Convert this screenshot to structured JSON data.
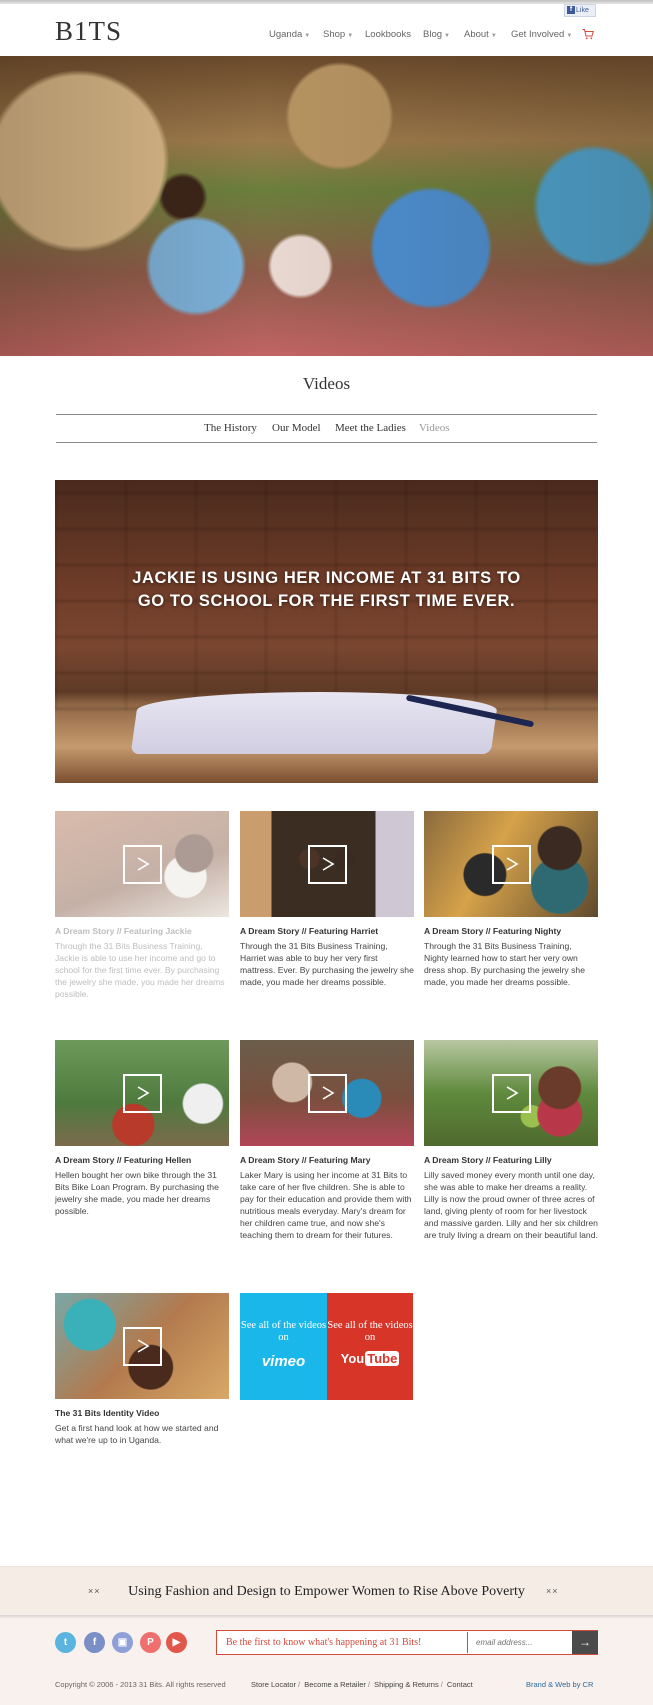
{
  "header": {
    "logo": "B1TS",
    "fb_like": "Like",
    "nav": [
      {
        "label": "Uganda",
        "dropdown": true
      },
      {
        "label": "Shop",
        "dropdown": true
      },
      {
        "label": "Lookbooks",
        "dropdown": false
      },
      {
        "label": "Blog",
        "dropdown": true
      },
      {
        "label": "About",
        "dropdown": true
      },
      {
        "label": "Get Involved",
        "dropdown": true
      }
    ],
    "cart_icon": "cart-icon"
  },
  "page": {
    "title": "Videos",
    "subnav": [
      {
        "label": "The History",
        "active": false
      },
      {
        "label": "Our Model",
        "active": false
      },
      {
        "label": "Meet the Ladies",
        "active": false
      },
      {
        "label": "Videos",
        "active": true
      }
    ]
  },
  "feature": {
    "line1": "JACKIE IS USING HER INCOME AT 31 BITS TO",
    "line2": "GO TO SCHOOL FOR THE FIRST TIME EVER."
  },
  "videos": [
    {
      "title": "A Dream Story // Featuring Jackie",
      "desc": "Through the 31 Bits Business Training, Jackie is able to use her income and go to school for the first time ever. By purchasing the jewelry she made, you made her dreams possible.",
      "faded": true
    },
    {
      "title": "A Dream Story // Featuring Harriet",
      "desc": "Through the 31 Bits Business Training, Harriet was able to buy her very first mattress. Ever. By purchasing the jewelry she made, you made her dreams possible.",
      "faded": false
    },
    {
      "title": "A Dream Story // Featuring Nighty",
      "desc": "Through the 31 Bits Business Training, Nighty learned how to start her very own dress shop. By purchasing the jewelry she made, you made her dreams possible.",
      "faded": false
    },
    {
      "title": "A Dream Story // Featuring Hellen",
      "desc": "Hellen bought her own bike through the 31 Bits Bike Loan Program. By purchasing the jewelry she made, you made her dreams possible.",
      "faded": false
    },
    {
      "title": "A Dream Story // Featuring Mary",
      "desc": "Laker Mary is using her income at 31 Bits to take care of her five children. She is able to pay for their education and provide them with nutritious meals everyday. Mary's dream for her children came true, and now she's teaching them to dream for their futures.",
      "faded": false
    },
    {
      "title": "A Dream Story // Featuring Lilly",
      "desc": "Lilly saved money every month until one day, she was able to make her dreams a reality. Lilly is now the proud owner of three acres of land, giving plenty of room for her livestock and massive garden. Lilly and her six children are truly living a dream on their beautiful land.",
      "faded": false
    },
    {
      "title": "The 31 Bits Identity Video",
      "desc": "Get a first hand look at how we started and what we're up to in Uganda.",
      "faded": false
    }
  ],
  "promo": {
    "vimeo_text": "See all of the videos on",
    "vimeo_logo": "vimeo",
    "youtube_text": "See all of the videos on",
    "youtube_logo_you": "You",
    "youtube_logo_tube": "Tube"
  },
  "footer": {
    "tagline": "Using Fashion and Design to Empower Women to Rise Above Poverty",
    "tagline_mark": "××",
    "social": [
      {
        "name": "twitter-icon",
        "glyph": "t",
        "color": "#5bb4e0"
      },
      {
        "name": "facebook-icon",
        "glyph": "f",
        "color": "#7a8fc6"
      },
      {
        "name": "instagram-icon",
        "glyph": "▣",
        "color": "#8f9fd8"
      },
      {
        "name": "pinterest-icon",
        "glyph": "P",
        "color": "#ef6f6f"
      },
      {
        "name": "youtube-icon",
        "glyph": "▶",
        "color": "#e2574c"
      }
    ],
    "newsletter_text": "Be the first to know what's happening at 31 Bits!",
    "email_placeholder": "email address...",
    "submit_glyph": "→",
    "copyright": "Copyright © 2006 - 2013 31 Bits. All rights reserved",
    "links": [
      "Store Locator",
      "Become a Retailer",
      "Shipping & Returns",
      "Contact"
    ],
    "credit": "Brand & Web by CR"
  }
}
